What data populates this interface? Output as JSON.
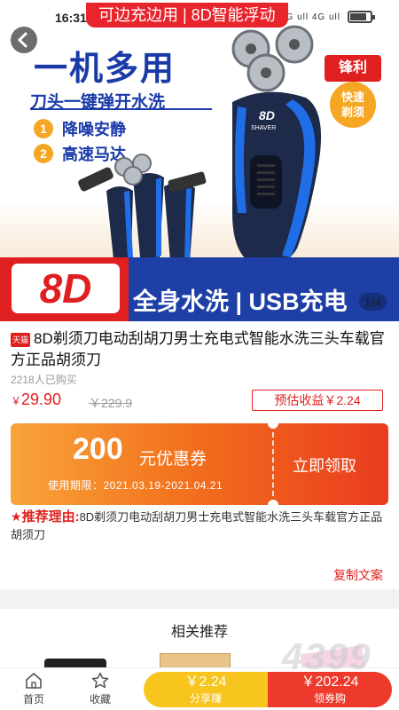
{
  "status_bar": {
    "time": "16:31",
    "battery_level": 0.8,
    "signal_text": "4G ull 4G ull"
  },
  "floating_banner": "可边充边用 | 8D智能浮动",
  "hero": {
    "title": "一机多用",
    "subtitle": "刀头一键弹开水洗",
    "features": [
      {
        "num": "1",
        "text": "降噪安静"
      },
      {
        "num": "2",
        "text": "高速马达"
      }
    ],
    "badge_sharp": "锋利",
    "badge_fast_line1": "快速",
    "badge_fast_line2": "剃须",
    "shaver_brand": "8D",
    "shaver_model": "SHAVER",
    "banner_big": "8D",
    "banner_text": "全身水洗 | USB充电",
    "image_counter": "1/4"
  },
  "product": {
    "tmall_tag": "天猫",
    "title": "8D剃须刀电动刮胡刀男士充电式智能水洗三头车载官方正品胡须刀",
    "sold": "2218人已购买",
    "price_symbol": "￥",
    "price": "29.90",
    "original_price": "￥229.9",
    "estimated_earnings": "预估收益￥2.24"
  },
  "coupon": {
    "amount": "200",
    "unit": "元优惠券",
    "validity": "使用期限：2021.03.19-2021.04.21",
    "claim_label": "立即领取"
  },
  "recommend": {
    "label": "推荐理由:",
    "text": "8D剃须刀电动刮胡刀男士充电式智能水洗三头车载官方正品胡须刀",
    "copy_label": "复制文案"
  },
  "related": {
    "title": "相关推荐"
  },
  "bottom_nav": {
    "home_label": "首页",
    "favorite_label": "收藏",
    "share_amount": "￥2.24",
    "share_label": "分享赚",
    "buy_amount": "￥202.24",
    "buy_label": "领券购"
  },
  "watermark": "4399",
  "colors": {
    "accent_red": "#e02020",
    "brand_blue": "#1a3aa8",
    "share_yellow": "#f7c51e",
    "buy_red": "#ee3a2c",
    "coupon_orange": "#f2721d"
  }
}
